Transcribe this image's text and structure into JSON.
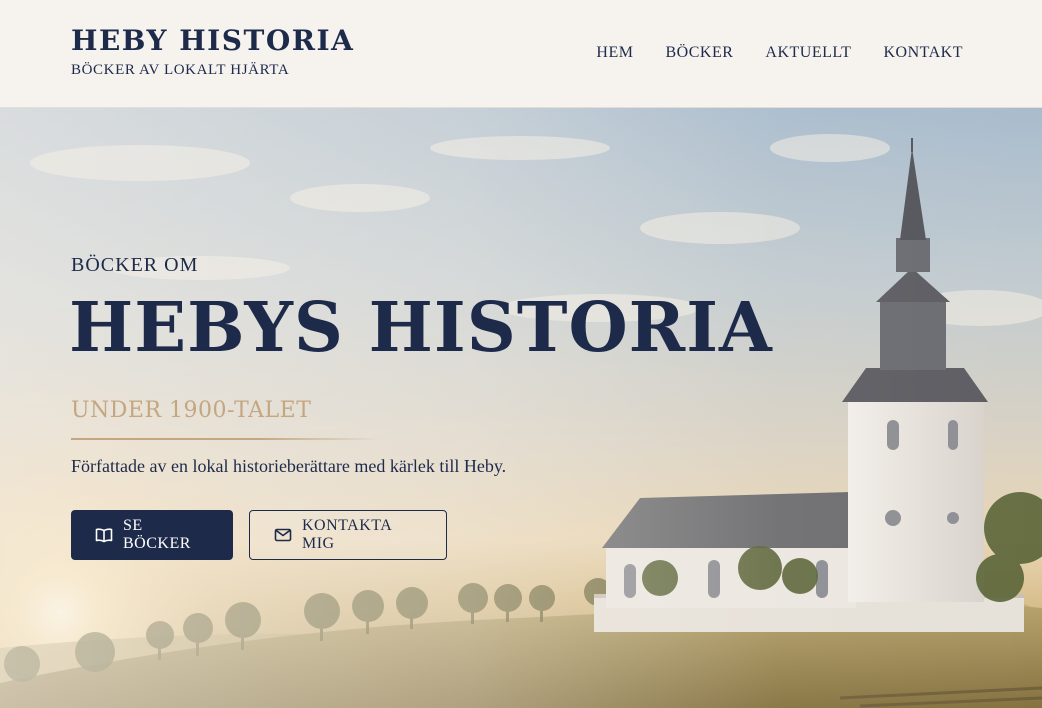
{
  "header": {
    "title": "HEBY HISTORIA",
    "subtitle": "BÖCKER AV LOKALT HJÄRTA",
    "nav": [
      {
        "label": "HEM"
      },
      {
        "label": "BÖCKER"
      },
      {
        "label": "AKTUELLT"
      },
      {
        "label": "KONTAKT"
      }
    ]
  },
  "hero": {
    "eyebrow": "BÖCKER OM",
    "title": "HEBYS HISTORIA",
    "subtitle": "UNDER 1900-TALET",
    "description": "Författade av en lokal historieberättare med kärlek till Heby.",
    "primary_button": {
      "label": "SE BÖCKER",
      "icon": "book-open-icon"
    },
    "secondary_button": {
      "label": "KONTAKTA MIG",
      "icon": "mail-icon"
    }
  },
  "colors": {
    "navy": "#1e2a4a",
    "gold": "#c4a680",
    "cream": "#f6f3ef"
  }
}
